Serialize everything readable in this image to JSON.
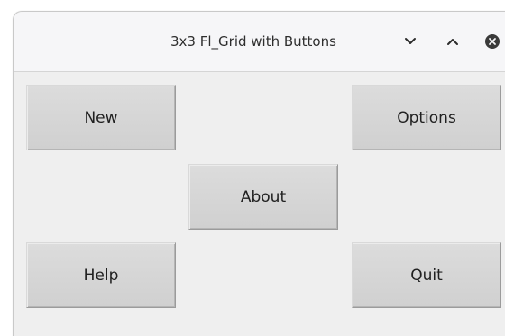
{
  "window": {
    "title": "3x3 Fl_Grid with Buttons",
    "controls": {
      "minimize_icon": "chevron-down-icon",
      "maximize_icon": "chevron-up-icon",
      "close_icon": "close-icon"
    }
  },
  "grid": {
    "buttons": {
      "new": "New",
      "options": "Options",
      "about": "About",
      "help": "Help",
      "quit": "Quit"
    }
  },
  "colors": {
    "titlebar_bg": "#f6f6f8",
    "client_bg": "#efefef",
    "button_bg": "#d6d6d6",
    "text": "#202020"
  }
}
